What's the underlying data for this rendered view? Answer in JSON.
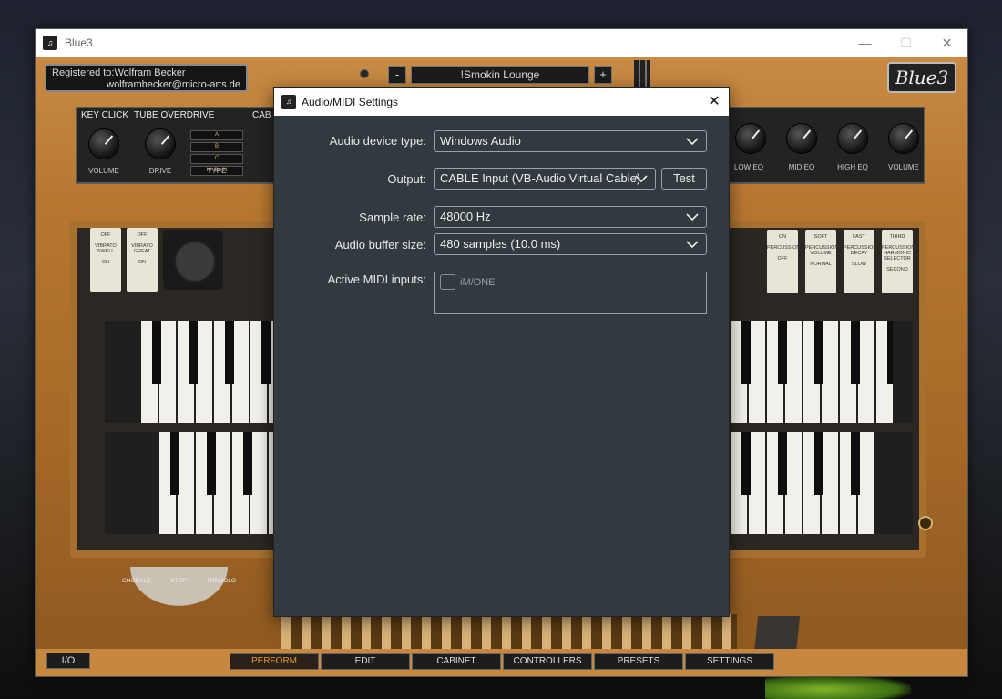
{
  "window": {
    "title": "Blue3"
  },
  "registration": {
    "line1": "Registered to:Wolfram Becker",
    "line2": "wolframbecker@micro-arts.de"
  },
  "preset": {
    "minus": "-",
    "name": "!Smokin Lounge",
    "plus": "+"
  },
  "logo": "Blue3",
  "effects": {
    "key_click": "KEY CLICK",
    "tube_overdrive": "TUBE OVERDRIVE",
    "cabinet_partial": "CAB",
    "volume_cap": "VOLUME",
    "drive_cap": "DRIVE",
    "type_cap": "TYPE",
    "type_options": [
      "A",
      "B",
      "C",
      "HI-GAIN"
    ],
    "low_eq": "LOW EQ",
    "mid_eq": "MID EQ",
    "high_eq": "HIGH EQ",
    "eq_volume": "VOLUME"
  },
  "tabs_left": [
    {
      "top": "OFF",
      "mid": "VIBRATO SWELL",
      "bottom": "ON"
    },
    {
      "top": "OFF",
      "mid": "VIBRATO GREAT",
      "bottom": "ON"
    }
  ],
  "tabs_right": [
    {
      "top": "ON",
      "mid": "PERCUSSION",
      "bottom": "OFF"
    },
    {
      "top": "SOFT",
      "mid": "PERCUSSION VOLUME",
      "bottom": "NORMAL"
    },
    {
      "top": "FAST",
      "mid": "PERCUSSION DECAY",
      "bottom": "SLOW"
    },
    {
      "top": "THIRD",
      "mid": "PERCUSSION HARMONIC SELECTOR",
      "bottom": "SECOND"
    }
  ],
  "vibrato_selector": {
    "chorale": "CHORALE",
    "stop": "STOP",
    "tremolo": "TREMOLO"
  },
  "bottom_nav": {
    "io": "I/O",
    "tabs": [
      "PERFORM",
      "EDIT",
      "CABINET",
      "CONTROLLERS",
      "PRESETS",
      "SETTINGS"
    ],
    "active_tab": "PERFORM"
  },
  "dialog": {
    "title": "Audio/MIDI Settings",
    "device_type_label": "Audio device type:",
    "device_type_value": "Windows Audio",
    "output_label": "Output:",
    "output_value": "CABLE Input (VB-Audio Virtual Cable)",
    "test_label": "Test",
    "sample_rate_label": "Sample rate:",
    "sample_rate_value": "48000 Hz",
    "buffer_label": "Audio buffer size:",
    "buffer_value": "480 samples (10.0 ms)",
    "midi_label": "Active MIDI inputs:",
    "midi_inputs": [
      {
        "name": "iM/ONE",
        "checked": false
      }
    ]
  },
  "colors": {
    "dialog_bg": "#323a3f",
    "accent_active": "#e29a2b",
    "wood": "#c4843e"
  }
}
